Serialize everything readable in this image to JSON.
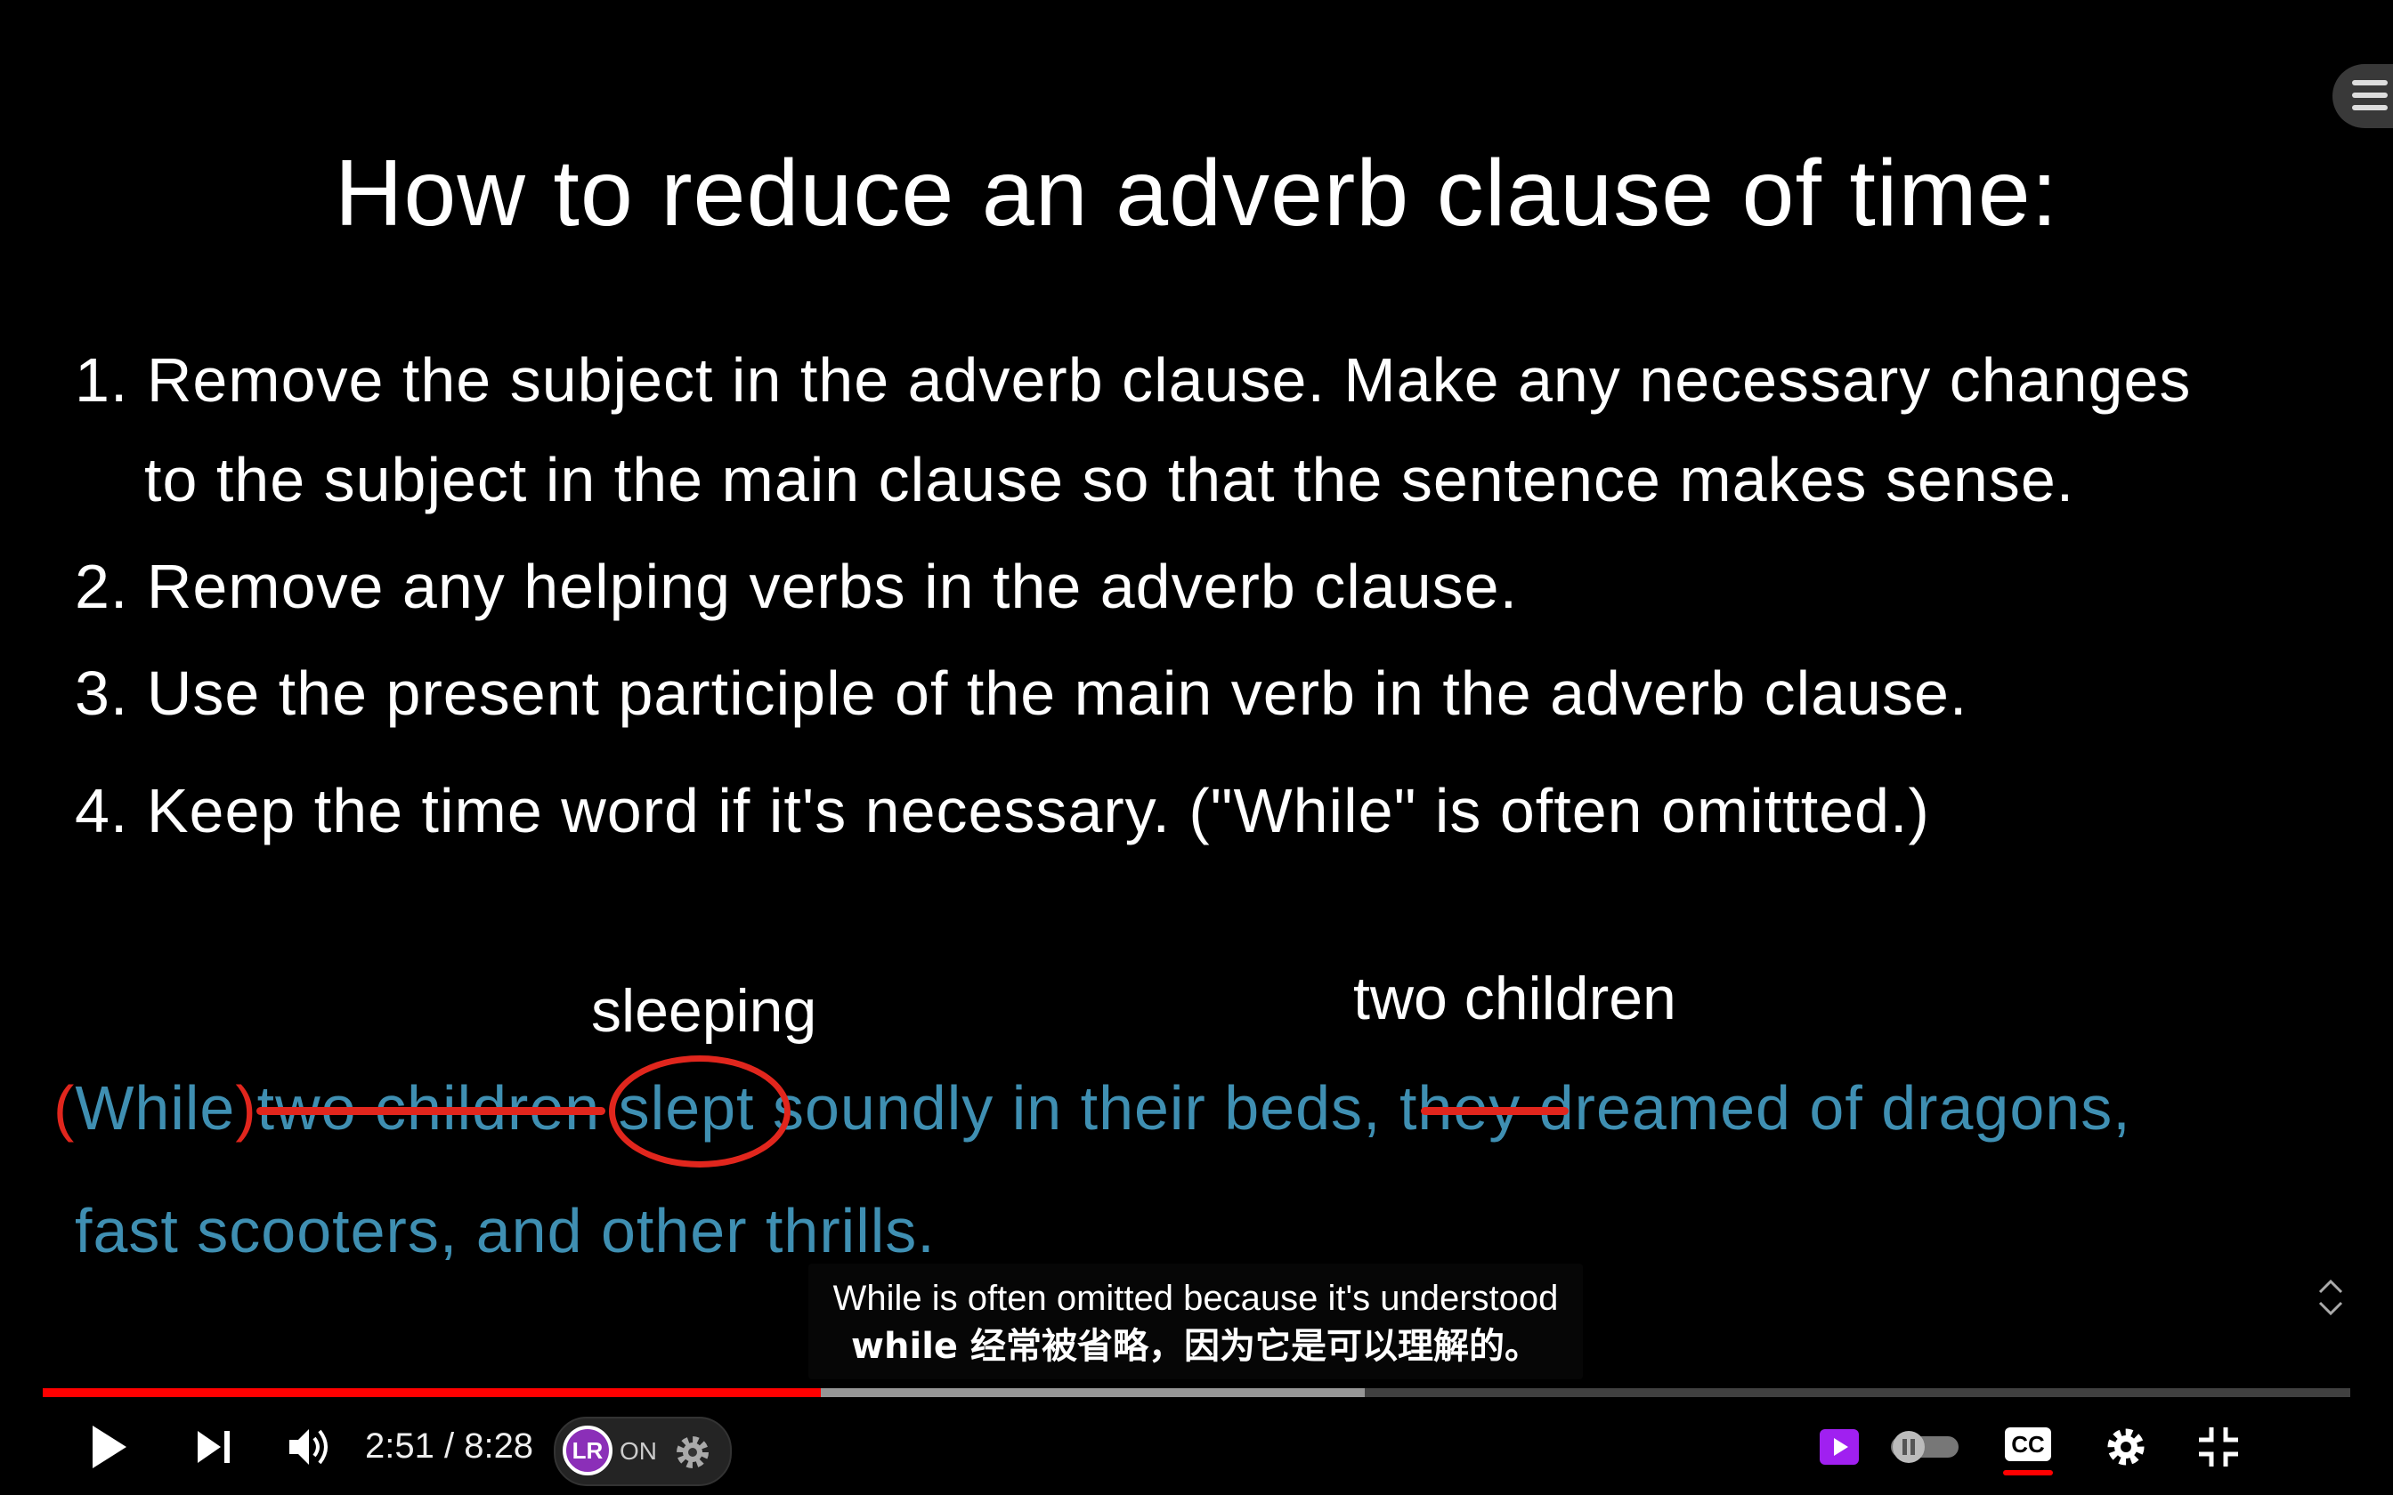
{
  "slide": {
    "title": "How to reduce an adverb clause of time:",
    "steps": [
      {
        "line1": "1. Remove the subject in the adverb clause.  Make any necessary changes",
        "line2": "to the subject in the main clause so that the sentence makes sense."
      },
      {
        "line1": "2. Remove any helping verbs in the adverb clause."
      },
      {
        "line1": "3. Use the present participle of the main verb in the adverb clause."
      },
      {
        "line1": "4. Keep the time word if it's necessary. (\"While\" is often omittted.)"
      }
    ],
    "annotations": {
      "sleeping": "sleeping",
      "two_children": "two children"
    },
    "example": {
      "paren_open": "(",
      "while": "While",
      "paren_close": ")",
      "struck_subject": "two children",
      "circled_verb": "slept",
      "after_verb": "soundly in their beds,",
      "struck_pronoun": "they",
      "rest": "dreamed of dragons,",
      "line2": "fast scooters, and other thrills."
    }
  },
  "captions": {
    "line1": "While is often omitted because it's understood",
    "line2": "while 经常被省略，因为它是可以理解的。"
  },
  "player": {
    "current_time": "2:51",
    "separator": " / ",
    "duration": "8:28",
    "played_fraction": 0.337,
    "buffered_fraction": 0.573,
    "extension_label": "ON",
    "extension_logo": "LR",
    "cc_label": "CC"
  },
  "icons": {
    "play": "play-icon",
    "next": "next-icon",
    "volume": "volume-icon",
    "settings": "gear-icon",
    "fullscreen_exit": "exit-fullscreen-icon",
    "menu": "menu-icon",
    "expand": "expand-collapse-icon"
  },
  "colors": {
    "progress_played": "#ff0000",
    "sentence_blue": "#3f8fb2",
    "annotation_red": "#e1261d",
    "extension_purple": "#8b2fb8",
    "miniplayer_purple": "#a020f0"
  }
}
